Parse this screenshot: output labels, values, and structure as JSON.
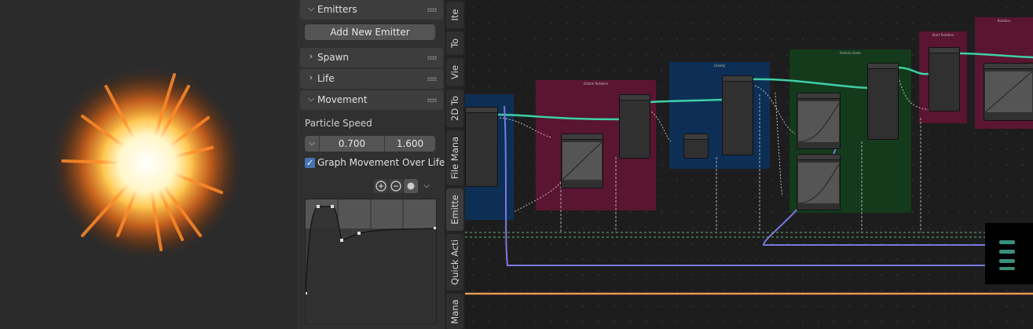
{
  "properties": {
    "emitters_header": "Emitters",
    "add_emitter_button": "Add New Emitter",
    "spawn_header": "Spawn",
    "life_header": "Life",
    "movement_header": "Movement",
    "particle_speed_label": "Particle Speed",
    "speed_min": "0.700",
    "speed_max": "1.600",
    "graph_checkbox_label": "Graph Movement Over Lifet...",
    "graph_checkbox_checked": true
  },
  "sidebar_tabs": [
    "Ite",
    "To",
    "Vie",
    "2D To",
    "File Mana",
    "Emitte",
    "Quick Acti",
    "Mana"
  ],
  "node_frames": [
    {
      "title": "Orbital Rotation",
      "color": "#5a1530"
    },
    {
      "title": "Gravity",
      "color": "#0e2f55"
    },
    {
      "title": "Particle Scale",
      "color": "#143a1c"
    },
    {
      "title": "Start Rotation",
      "color": "#5a1530"
    },
    {
      "title": "Rotation",
      "color": "#5a1530"
    }
  ],
  "colors": {
    "accent": "#4772b3",
    "link_teal": "#3ecfa6",
    "link_purple": "#7b78e0",
    "link_orange": "#e59a55",
    "link_green_dashed": "#6fae7b"
  }
}
